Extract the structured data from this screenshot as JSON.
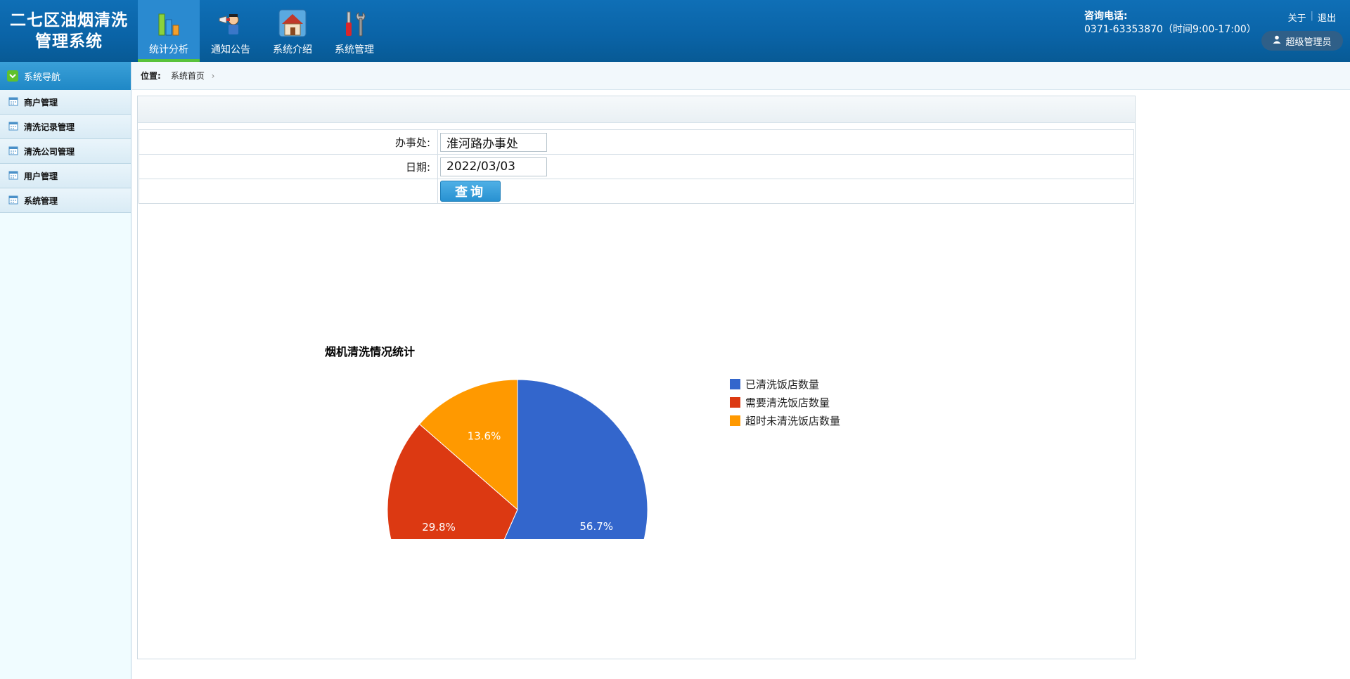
{
  "header": {
    "logo_line1": "二七区油烟清洗",
    "logo_line2": "管理系统",
    "nav": [
      {
        "label": "统计分析",
        "icon": "bar-chart-icon",
        "active": true
      },
      {
        "label": "通知公告",
        "icon": "megaphone-icon",
        "active": false
      },
      {
        "label": "系统介绍",
        "icon": "house-icon",
        "active": false
      },
      {
        "label": "系统管理",
        "icon": "tools-icon",
        "active": false
      }
    ],
    "contact_title": "咨询电话:",
    "contact_phone": "0371-63353870（时间9:00-17:00）",
    "about_link": "关于",
    "logout_link": "退出",
    "user_name": "超级管理员"
  },
  "sidebar": {
    "title": "系统导航",
    "items": [
      "商户管理",
      "清洗记录管理",
      "清洗公司管理",
      "用户管理",
      "系统管理"
    ]
  },
  "breadcrumb": {
    "label": "位置:",
    "page": "系统首页"
  },
  "form": {
    "office_label": "办事处:",
    "office_value": "淮河路办事处",
    "date_label": "日期:",
    "date_value": "2022/03/03",
    "query_label": "查询"
  },
  "chart_data": {
    "type": "pie",
    "title": "烟机清洗情况统计",
    "categories": [
      "已清洗饭店数量",
      "需要清洗饭店数量",
      "超时未清洗饭店数量"
    ],
    "values": [
      56.7,
      29.8,
      13.6
    ],
    "value_labels": [
      "56.7%",
      "29.8%",
      "13.6%"
    ],
    "colors": [
      "#3366cc",
      "#dc3912",
      "#ff9900"
    ],
    "legend": "right"
  }
}
